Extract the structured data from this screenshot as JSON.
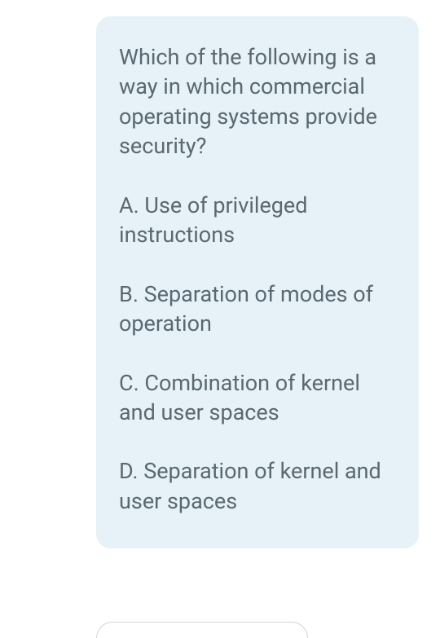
{
  "message": {
    "question": "Which of the following is a way in which commercial operating systems provide security?",
    "options": {
      "a": "A. Use of privileged instructions",
      "b": "B. Separation of modes of operation",
      "c": "C. Combination of kernel and user spaces",
      "d": "D. Separation of kernel and user spaces"
    }
  }
}
